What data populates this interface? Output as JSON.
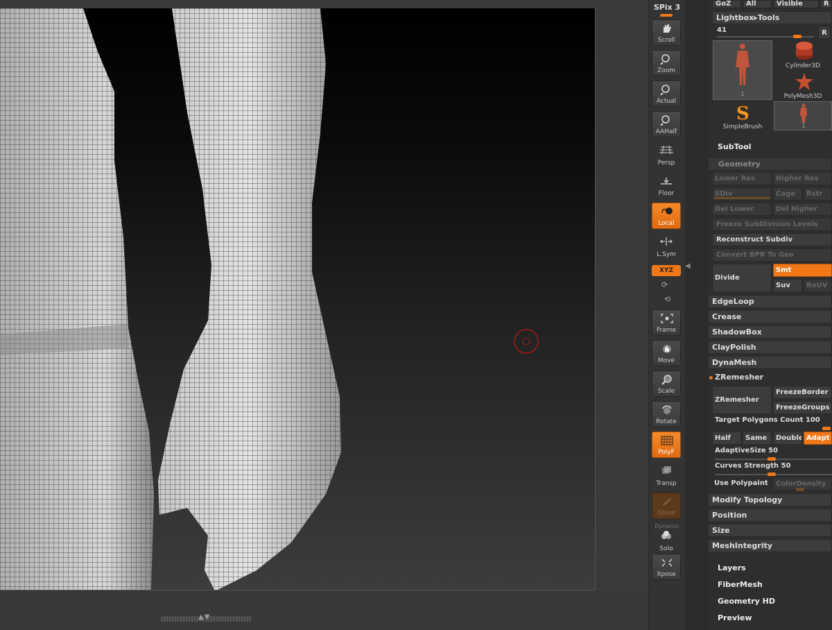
{
  "top_buttons": [
    "GoZ",
    "All",
    "Visible",
    "R"
  ],
  "lightbox_tools": "Lightbox▸Tools",
  "tool_count": "41",
  "r_button": "R",
  "tools": [
    "Cylinder3D",
    "PolyMesh3D",
    "SimpleBrush"
  ],
  "thumb_index_1": "1",
  "thumb_index_2": "1",
  "shelf": {
    "spix": "SPix 3",
    "buttons": [
      "Scroll",
      "Zoom",
      "Actual",
      "AAHalf",
      "Persp",
      "Floor",
      "Local",
      "L.Sym",
      "Frame",
      "Move",
      "Scale",
      "Rotate",
      "PolyF",
      "Transp",
      "Ghost",
      "Solo",
      "Xpose"
    ],
    "xyz": "XYZ",
    "dynamic": "Dynamic"
  },
  "panel": {
    "subtool": "SubTool",
    "geometry": "Geometry",
    "lower_res": "Lower Res",
    "higher_res": "Higher Res",
    "sdiv": "SDiv",
    "cage": "Cage",
    "rstr": "Rstr",
    "del_lower": "Del Lower",
    "del_higher": "Del Higher",
    "freeze_subdiv": "Freeze SubDivision Levels",
    "reconstruct": "Reconstruct Subdiv",
    "convert_bpr": "Convert BPR To Geo",
    "divide": "Divide",
    "smt": "Smt",
    "suv": "Suv",
    "reuv": "ReUV",
    "edgeloop": "EdgeLoop",
    "crease": "Crease",
    "shadowbox": "ShadowBox",
    "claypolish": "ClayPolish",
    "dynamesh": "DynaMesh",
    "zremesher_head": "ZRemesher",
    "zremesher_btn": "ZRemesher",
    "freeze_border": "FreezeBorder",
    "freeze_groups": "FreezeGroups",
    "target_label": "Target Polygons Count",
    "target_value": "100",
    "half": "Half",
    "same": "Same",
    "double": "Double",
    "adapt": "Adapt",
    "adaptive_label": "AdaptiveSize",
    "adaptive_value": "50",
    "curves_label": "Curves Strength",
    "curves_value": "50",
    "use_polypaint": "Use Polypaint",
    "color_density": "ColorDensity",
    "modify_topology": "Modify Topology",
    "position": "Position",
    "size": "Size",
    "mesh_integrity": "MeshIntegrity",
    "layers": "Layers",
    "fibermesh": "FiberMesh",
    "geometry_hd": "Geometry HD",
    "preview": "Preview"
  },
  "colors": {
    "accent": "#f07818",
    "panel": "#2e2e2e"
  }
}
